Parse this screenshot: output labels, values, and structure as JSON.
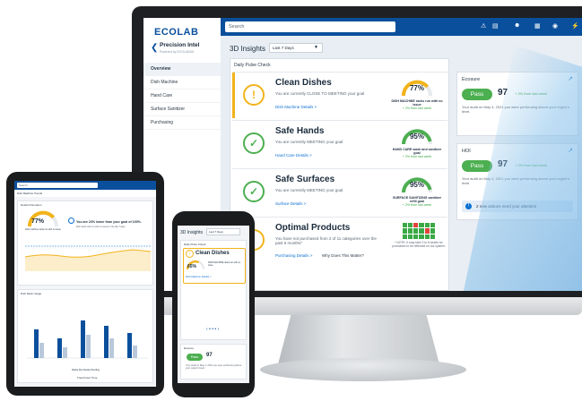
{
  "app": {
    "brand": "ECOLAB",
    "title": "Precision Intel",
    "subtitle": "Powered by ECOLAB3D"
  },
  "nav": {
    "back_icon": "chevron-left-icon",
    "items": [
      {
        "label": "Overview",
        "active": true
      },
      {
        "label": "Dish Machine",
        "active": false
      },
      {
        "label": "Hand Care",
        "active": false
      },
      {
        "label": "Surface Sanitizer",
        "active": false
      },
      {
        "label": "Purchasing",
        "active": false
      }
    ]
  },
  "topbar": {
    "search_placeholder": "Search",
    "icons": [
      "alert-icon",
      "cart-icon",
      "people-icon",
      "building-icon",
      "user-icon",
      "bolt-icon"
    ]
  },
  "main": {
    "title": "3D Insights",
    "date_range": "Last 7 Days",
    "pulse_title": "Daily Pulse Check",
    "cards": [
      {
        "heading": "Clean Dishes",
        "status": "You are currently CLOSE TO MEETING your goal",
        "link": "Dish Machine Details >",
        "gauge_pct": "77%",
        "gauge_value": 0.77,
        "gauge_label": "DISH MACHINE racks run with no issue",
        "gauge_delta": "+ 2% from last week",
        "status_color": "#f2b31b"
      },
      {
        "heading": "Safe Hands",
        "status": "You are currently MEETING your goal",
        "link": "Hand Care Details >",
        "gauge_pct": "95%",
        "gauge_value": 0.95,
        "gauge_label": "HAND CARE wash and sanitizer goal",
        "gauge_delta": "+ 2% from last week",
        "status_color": "#4caf50"
      },
      {
        "heading": "Safe Surfaces",
        "status": "You are currently MEETING your goal",
        "link": "Surface Details >",
        "gauge_pct": "95%",
        "gauge_value": 0.95,
        "gauge_label": "SURFACE SANITIZING sanitizer refill goal",
        "gauge_delta": "+ 2% from last week",
        "status_color": "#4caf50"
      },
      {
        "heading": "Optimal Products",
        "status": "You have not purchased from 2 of 11 categories over the past 6 months*",
        "link": "Purchasing Details >",
        "link2": "Why Does This Matter?",
        "note": "* NOTE: It may take 3 to 6 weeks for purchases to be reflected on our system.",
        "status_color": "#f2b31b"
      }
    ]
  },
  "right": {
    "ecosure": {
      "title": "Ecosure",
      "pass": "Pass",
      "score": "97",
      "delta": "+ 2% from last week",
      "text": "Your audit on May 4, 2021 you were performing above your region's level."
    },
    "hoi": {
      "title": "HOI",
      "pass": "Pass",
      "score": "97",
      "delta": "+ 2% from last week",
      "text": "Your audit on May 4, 2021 you were performing above your region's level.",
      "action": "2 new actions need your attention"
    }
  },
  "tablet": {
    "search": "Search",
    "filter": "Dish Machine Trends",
    "panel1_title": "Detail Information",
    "gauge_pct": "77%",
    "gauge_label": "Dish machine racks run with no issue",
    "msg": "You are 23% lower than your goal of 100%.",
    "msg_sub": "Dish wash rack run with no issues in the last 7 days",
    "trend_label": "Trend Over Time",
    "panel2_title": "Dish Rack Usage",
    "legend": "Racks Run   Racks Pending"
  },
  "phone": {
    "title": "3D Insights",
    "select": "Last 7 Days",
    "pulse_caption": "Daily Pulse Check",
    "card_heading": "Clean Dishes",
    "gauge_pct": "65%",
    "gauge_label": "DISH MACHINE racks run with no issue",
    "link": "Dish Machine Details >",
    "ecosure_caption": "Ecosure",
    "pass": "Pass",
    "score": "97",
    "text": "Your audit on May 4, 2021 you were performing above your region's level."
  }
}
